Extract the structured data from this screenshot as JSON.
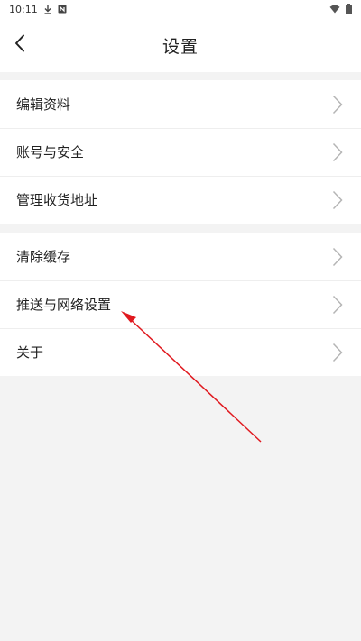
{
  "status_bar": {
    "time": "10:11",
    "left_icons": [
      "download-icon",
      "notification-icon"
    ],
    "right_icons": [
      "wifi-icon",
      "battery-icon"
    ]
  },
  "header": {
    "title": "设置",
    "back_icon": "chevron-left-icon"
  },
  "groups": [
    {
      "items": [
        {
          "label": "编辑资料"
        },
        {
          "label": "账号与安全"
        },
        {
          "label": "管理收货地址"
        }
      ]
    },
    {
      "items": [
        {
          "label": "清除缓存"
        },
        {
          "label": "推送与网络设置"
        },
        {
          "label": "关于"
        }
      ]
    }
  ],
  "colors": {
    "background": "#f3f3f3",
    "surface": "#ffffff",
    "annotation_arrow": "#e0191f",
    "chevron": "#b5b5b5"
  }
}
